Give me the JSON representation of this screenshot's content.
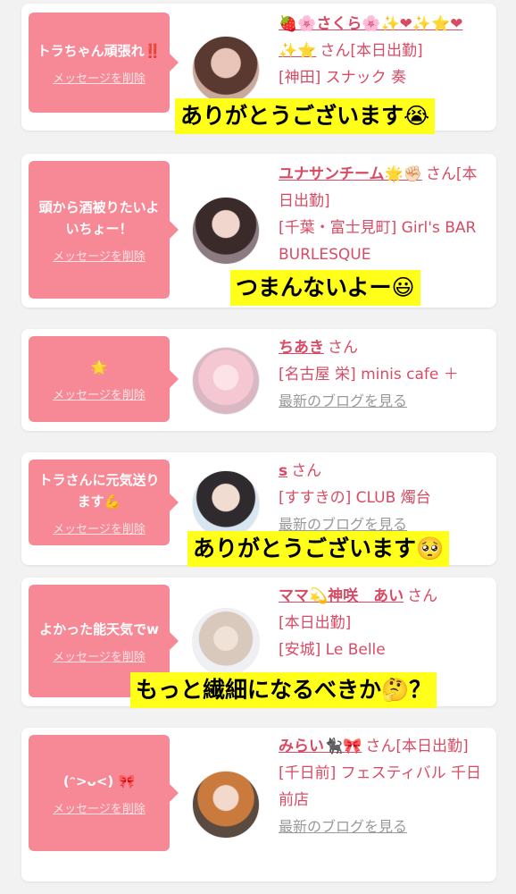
{
  "cards": [
    {
      "message": "トラちゃん頑張れ‼️",
      "delete_label": "メッセージを削除",
      "name": "🍓🌸さくら🌸✨❤✨⭐❤✨⭐",
      "san": "さん",
      "status": "[本日出勤]",
      "shop": "[神田] スナック 奏",
      "blog": "",
      "caption": "ありがとうございます😭"
    },
    {
      "message": "頭から酒被りたいよいちょー！",
      "delete_label": "メッセージを削除",
      "name": "ユナサンチーム🌟✊🏻",
      "san": "さん",
      "status": "[本日出勤]",
      "shop": "[千葉・富士見町] Girl's BAR BURLESQUE",
      "blog": "",
      "caption": "つまんないよー😃"
    },
    {
      "message": "🌟",
      "delete_label": "メッセージを削除",
      "name": "ちあき",
      "san": "さん",
      "status": "",
      "shop": "[名古屋 栄] minis cafe ＋",
      "blog": "最新のブログを見る",
      "caption": ""
    },
    {
      "message": "トラさんに元気送ります💪",
      "delete_label": "メッセージを削除",
      "name": "s",
      "san": "さん",
      "status": "",
      "shop": "[すすきの] CLUB 燭台",
      "blog": "最新のブログを見る",
      "caption": "ありがとうございます🥺"
    },
    {
      "message": "よかった能天気でw",
      "delete_label": "メッセージを削除",
      "name": "ママ💫神咲　あい",
      "san": "さん",
      "status": "[本日出勤]",
      "shop": "[安城] Le Belle",
      "blog": "",
      "caption": "もっと繊細になるべきか🤔？"
    },
    {
      "message": "(ᵔ>ᴗ<) 🎀",
      "delete_label": "メッセージを削除",
      "name": "みらい🐈‍⬛🎀",
      "san": "さん",
      "status": "[本日出勤]",
      "shop": "[千日前] フェスティバル 千日前店",
      "blog": "最新のブログを見る",
      "caption": ""
    }
  ],
  "colors": {
    "bubble": "#f78997",
    "accent_text": "#d84b64",
    "caption_bg": "#ffff1a"
  }
}
